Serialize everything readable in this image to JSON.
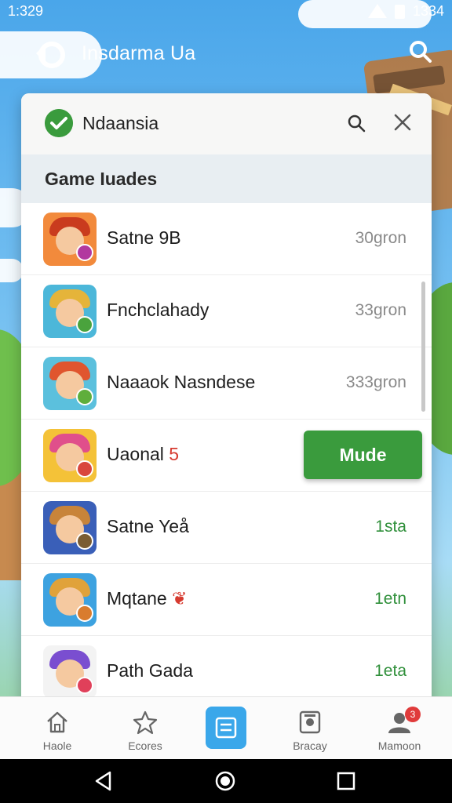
{
  "status": {
    "time": "1:329",
    "right_text": "1334"
  },
  "app": {
    "title": "Insdarma Ua"
  },
  "card": {
    "title": "Ndaansia",
    "section": "Game Iuades"
  },
  "rows": [
    {
      "name": "Satne 9B",
      "meta": "30gron",
      "meta_style": "gray"
    },
    {
      "name": "Fnchclahady",
      "meta": "33gron",
      "meta_style": "gray"
    },
    {
      "name": "Naaaok Nasndese",
      "meta": "333gron",
      "meta_style": "gray"
    },
    {
      "name": "Uaonal",
      "name_suffix": "5",
      "button": "Mude"
    },
    {
      "name": "Satne Yeå",
      "meta": "1sta",
      "meta_style": "green"
    },
    {
      "name": "Mqtane",
      "name_suffix": "❦",
      "meta": "1etn",
      "meta_style": "green"
    },
    {
      "name": "Path Gada",
      "meta": "1eta",
      "meta_style": "green"
    }
  ],
  "avatars": [
    {
      "bg": "#f28a3c",
      "hair": "#c93b1e",
      "badge": "#b2389f"
    },
    {
      "bg": "#4cb7d9",
      "hair": "#e5b43a",
      "badge": "#4aa33d"
    },
    {
      "bg": "#5bc0dd",
      "hair": "#e0552e",
      "badge": "#5fae3c"
    },
    {
      "bg": "#f4c238",
      "hair": "#e04f8b",
      "badge": "#d9473d"
    },
    {
      "bg": "#3a5fb8",
      "hair": "#c8843a",
      "badge": "#7a5c33"
    },
    {
      "bg": "#3da2e0",
      "hair": "#e0a23a",
      "badge": "#d97c2e"
    },
    {
      "bg": "#f3f3f3",
      "hair": "#7a4ed0",
      "badge": "#e0405a"
    }
  ],
  "nav": [
    {
      "label": "Haole",
      "icon": "home-icon"
    },
    {
      "label": "Ecores",
      "icon": "star-icon"
    },
    {
      "label": "",
      "icon": "list-icon"
    },
    {
      "label": "Bracay",
      "icon": "photo-icon"
    },
    {
      "label": "Mamoon",
      "icon": "person-icon",
      "badge": "3"
    }
  ],
  "colors": {
    "accent_green": "#3a9b3d",
    "nav_active": "#3aa7ea",
    "badge_red": "#e03b3b"
  }
}
